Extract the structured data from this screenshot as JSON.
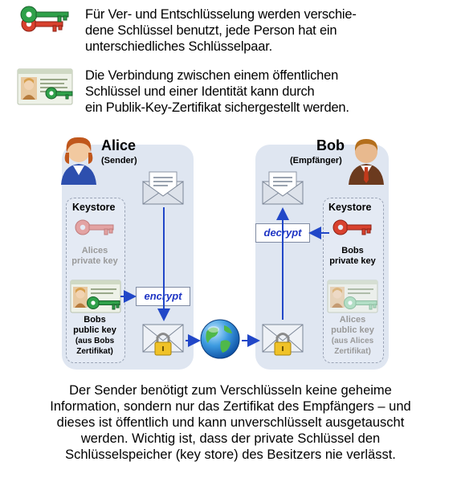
{
  "intro": {
    "para1_lines": [
      "Für Ver- und Entschlüsselung werden verschie-",
      "dene Schlüssel benutzt, jede Person hat  ein",
      "unterschiedliches Schlüsselpaar."
    ],
    "para2_lines": [
      "Die Verbindung zwischen einem öffentlichen",
      "Schlüssel und einer Identität kann durch",
      "ein Publik-Key-Zertifikat sichergestellt werden."
    ]
  },
  "alice": {
    "name": "Alice",
    "role": "(Sender)",
    "keystore_title": "Keystore",
    "private_key_lines": [
      "Alices",
      "private key"
    ],
    "public_key_lines": [
      "Bobs",
      "public key",
      "(aus Bobs",
      "Zertifikat)"
    ]
  },
  "bob": {
    "name": "Bob",
    "role": "(Empfänger)",
    "keystore_title": "Keystore",
    "private_key_lines": [
      "Bobs",
      "private key"
    ],
    "public_key_lines": [
      "Alices",
      "public key",
      "(aus Alices",
      "Zertifikat)"
    ]
  },
  "actions": {
    "encrypt": "encrypt",
    "decrypt": "decrypt"
  },
  "bottom_lines": [
    "Der Sender benötigt zum Verschlüsseln keine geheime",
    "Information, sondern nur das Zertifikat des Empfängers – und",
    "dieses ist öffentlich und kann unverschlüsselt ausgetauscht",
    "werden. Wichtig ist, dass der private Schlüssel den",
    "Schlüsselspeicher (key store) des Besitzers nie verlässt."
  ],
  "icons": {
    "key_pair": "key-pair-icon",
    "certificate": "certificate-icon",
    "person": "person-icon",
    "envelope_open": "envelope-icon",
    "envelope_locked": "locked-envelope-icon",
    "globe": "globe-icon"
  },
  "colors": {
    "panel": "#dfe6f1",
    "arrow": "#2147c8",
    "action_text": "#1f35c4",
    "green_key": "#2fa14a",
    "red_key": "#d8412e",
    "faded_red_key": "#e3a3a3",
    "faded_green_key": "#9ed9b2"
  }
}
